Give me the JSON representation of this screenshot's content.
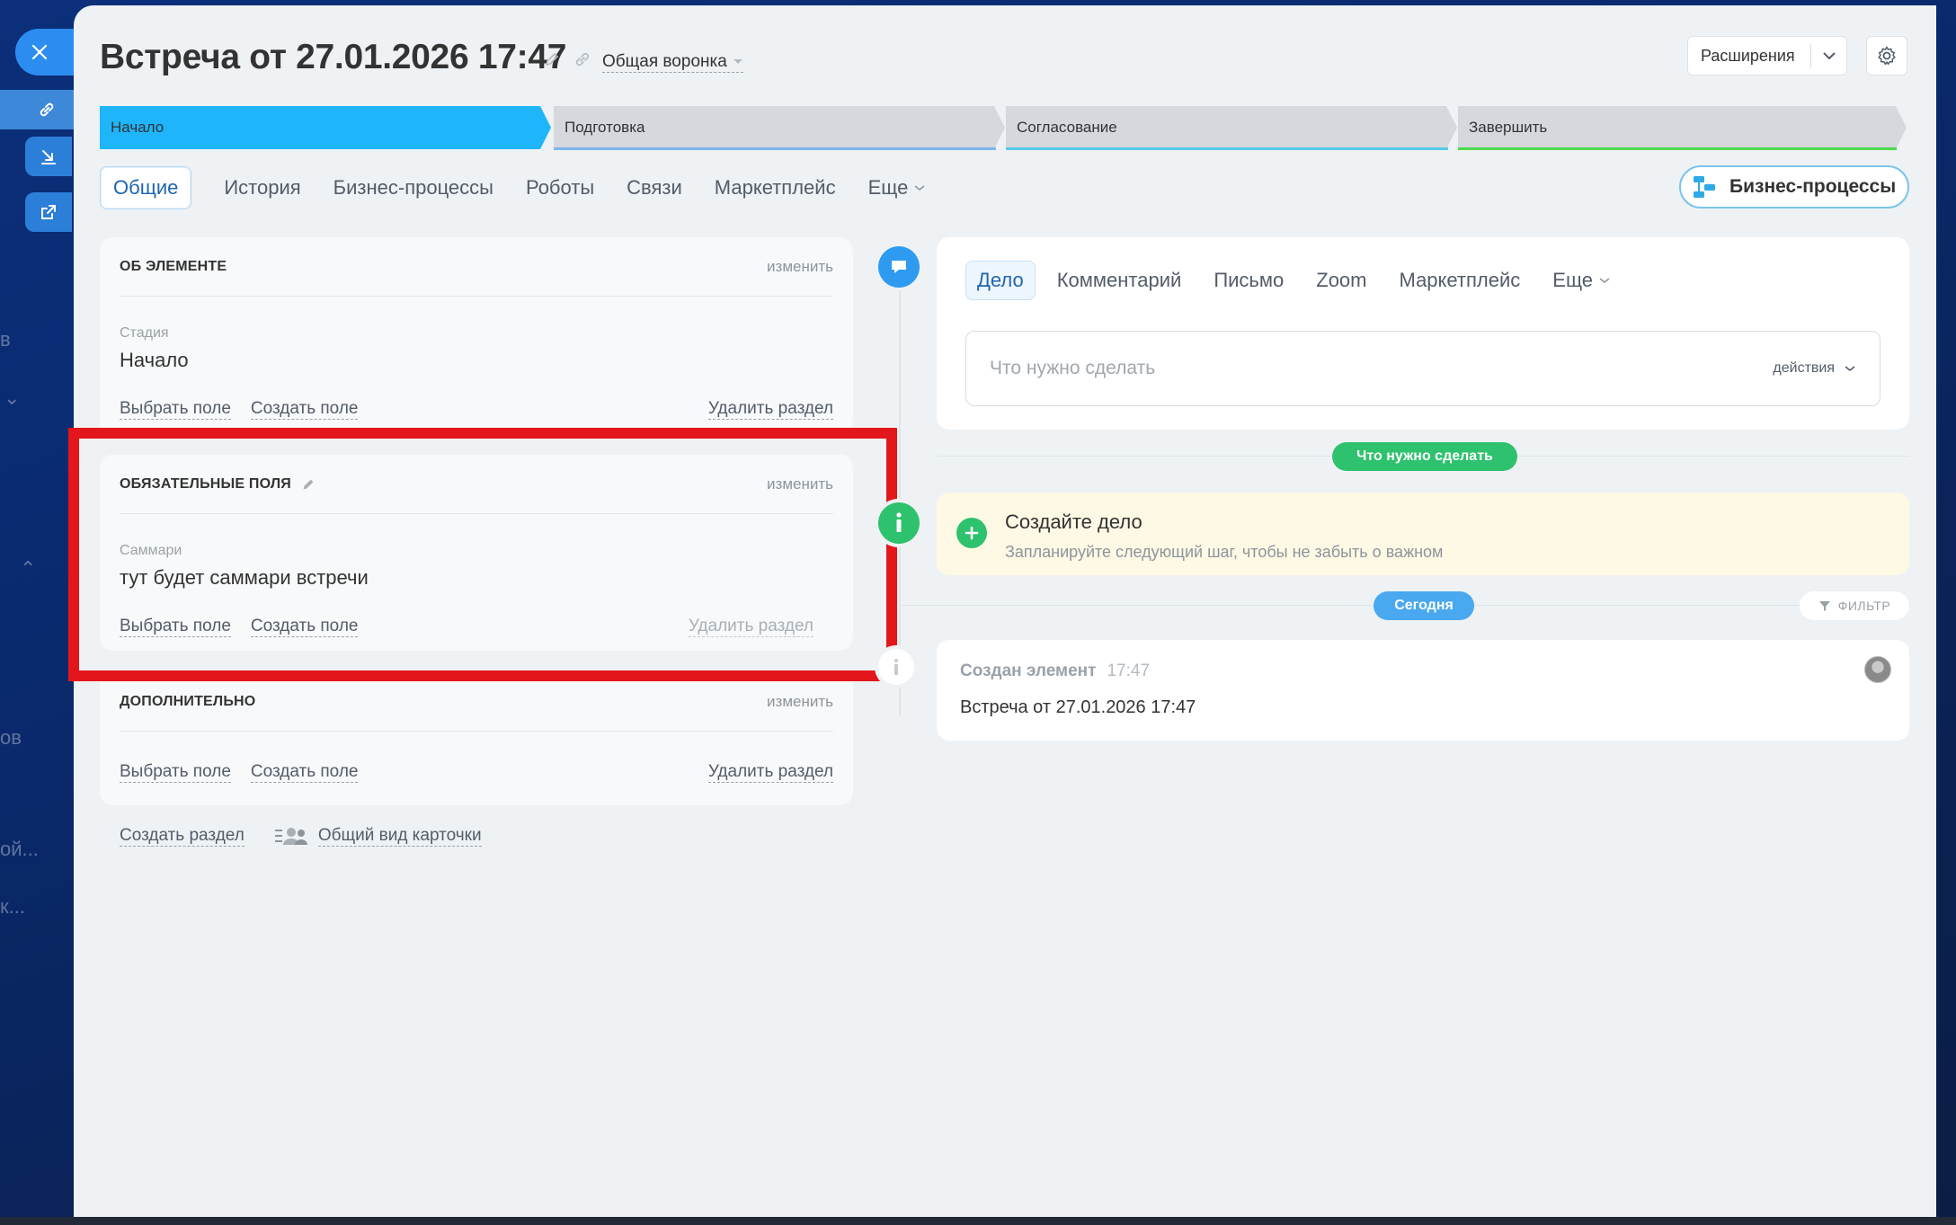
{
  "sidebar": {
    "icons": [
      "close-icon",
      "link-icon",
      "download-icon",
      "external-link-icon"
    ],
    "bg_fragments": [
      "в",
      "ов",
      "ой...",
      "к..."
    ]
  },
  "header": {
    "title": "Встреча от 27.01.2026 17:47",
    "funnel": "Общая воронка",
    "extensions_label": "Расширения"
  },
  "stages": [
    {
      "label": "Начало",
      "fill": "#1fb5fb",
      "bar": "#1fb5fb"
    },
    {
      "label": "Подготовка",
      "fill": "#d5d8dc",
      "bar": "#7db6f0"
    },
    {
      "label": "Согласование",
      "fill": "#d5d8dc",
      "bar": "#55c8e8"
    },
    {
      "label": "Завершить",
      "fill": "#d5d8dc",
      "bar": "#4dd94d"
    }
  ],
  "tabs": {
    "items": [
      "Общие",
      "История",
      "Бизнес-процессы",
      "Роботы",
      "Связи",
      "Маркетплейс",
      "Еще"
    ],
    "bp_button": "Бизнес-процессы"
  },
  "cards": {
    "about": {
      "title": "ОБ ЭЛЕМЕНТЕ",
      "edit": "изменить",
      "field_label": "Стадия",
      "field_value": "Начало",
      "select_field": "Выбрать поле",
      "create_field": "Создать поле",
      "delete_section": "Удалить раздел"
    },
    "required": {
      "title": "ОБЯЗАТЕЛЬНЫЕ ПОЛЯ",
      "edit": "изменить",
      "field_label": "Саммари",
      "field_value": "тут будет саммари встречи",
      "select_field": "Выбрать поле",
      "create_field": "Создать поле",
      "delete_section": "Удалить раздел"
    },
    "additional": {
      "title": "ДОПОЛНИТЕЛЬНО",
      "edit": "изменить",
      "select_field": "Выбрать поле",
      "create_field": "Создать поле",
      "delete_section": "Удалить раздел"
    }
  },
  "bottom_links": {
    "create_section": "Создать раздел",
    "card_view": "Общий вид карточки"
  },
  "activity": {
    "tabs": [
      "Дело",
      "Комментарий",
      "Письмо",
      "Zoom",
      "Маркетплейс",
      "Еще"
    ],
    "placeholder": "Что нужно сделать",
    "actions": "действия"
  },
  "timeline": {
    "todo_pill": "Что нужно сделать",
    "create_title": "Создайте дело",
    "create_sub": "Запланируйте следующий шаг, чтобы не забыть о важном",
    "today_pill": "Сегодня",
    "filter": "ФИЛЬТР",
    "history_title": "Создан элемент",
    "history_time": "17:47",
    "history_text": "Встреча от 27.01.2026 17:47"
  },
  "colors": {
    "accent": "#2066b0",
    "stage_active": "#1fb5fb",
    "green": "#2fc26e",
    "today": "#4aa8f0",
    "highlight": "#e3161b"
  }
}
